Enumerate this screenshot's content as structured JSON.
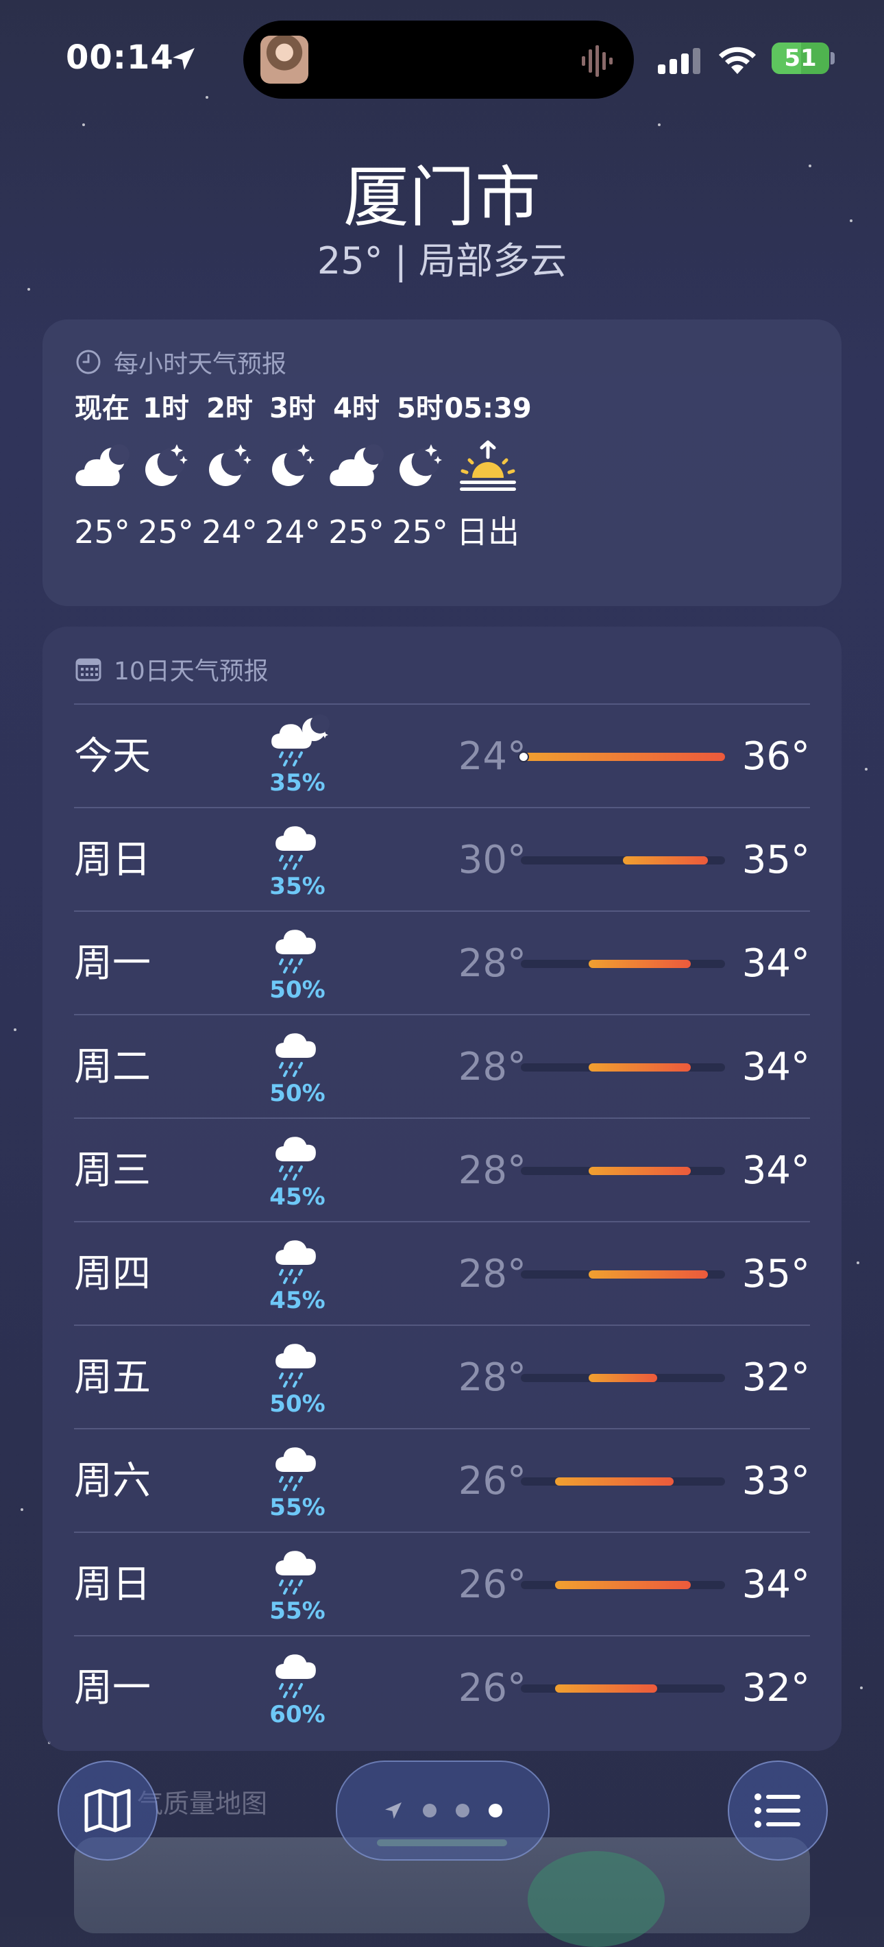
{
  "status_bar": {
    "time": "00:14",
    "battery": "51",
    "battery_level": 0.51,
    "icons": [
      "location-arrow-icon",
      "audio-wave-icon",
      "cellular-signal-icon",
      "wifi-icon",
      "battery-charging-icon"
    ]
  },
  "header": {
    "city": "厦门市",
    "summary": "25° | 局部多云"
  },
  "hourly": {
    "title": "每小时天气预报",
    "title_icon": "clock-icon",
    "items": [
      {
        "time": "现在",
        "icon": "partly-cloudy-night-icon",
        "temp": "25°"
      },
      {
        "time": "1时",
        "icon": "clear-night-icon",
        "temp": "25°"
      },
      {
        "time": "2时",
        "icon": "clear-night-icon",
        "temp": "24°"
      },
      {
        "time": "3时",
        "icon": "clear-night-icon",
        "temp": "24°"
      },
      {
        "time": "4时",
        "icon": "partly-cloudy-night-icon",
        "temp": "25°"
      },
      {
        "time": "5时",
        "icon": "clear-night-icon",
        "temp": "25°"
      },
      {
        "time": "05:39",
        "icon": "sunrise-icon",
        "temp": "日出"
      }
    ]
  },
  "daily": {
    "title": "10日天气预报",
    "title_icon": "calendar-icon",
    "scale_min": 24,
    "scale_max": 36,
    "days": [
      {
        "day": "今天",
        "icon": "rain-night-icon",
        "pop": "35%",
        "low": "24°",
        "high": "36°",
        "low_val": 24,
        "high_val": 36,
        "current_val": 24
      },
      {
        "day": "周日",
        "icon": "rain-icon",
        "pop": "35%",
        "low": "30°",
        "high": "35°",
        "low_val": 30,
        "high_val": 35
      },
      {
        "day": "周一",
        "icon": "rain-icon",
        "pop": "50%",
        "low": "28°",
        "high": "34°",
        "low_val": 28,
        "high_val": 34
      },
      {
        "day": "周二",
        "icon": "rain-icon",
        "pop": "50%",
        "low": "28°",
        "high": "34°",
        "low_val": 28,
        "high_val": 34
      },
      {
        "day": "周三",
        "icon": "rain-icon",
        "pop": "45%",
        "low": "28°",
        "high": "34°",
        "low_val": 28,
        "high_val": 34
      },
      {
        "day": "周四",
        "icon": "rain-icon",
        "pop": "45%",
        "low": "28°",
        "high": "35°",
        "low_val": 28,
        "high_val": 35
      },
      {
        "day": "周五",
        "icon": "rain-icon",
        "pop": "50%",
        "low": "28°",
        "high": "32°",
        "low_val": 28,
        "high_val": 32
      },
      {
        "day": "周六",
        "icon": "rain-icon",
        "pop": "55%",
        "low": "26°",
        "high": "33°",
        "low_val": 26,
        "high_val": 33
      },
      {
        "day": "周日",
        "icon": "rain-icon",
        "pop": "55%",
        "low": "26°",
        "high": "34°",
        "low_val": 26,
        "high_val": 34
      },
      {
        "day": "周一",
        "icon": "rain-icon",
        "pop": "60%",
        "low": "26°",
        "high": "32°",
        "low_val": 26,
        "high_val": 32
      }
    ]
  },
  "bottom": {
    "peek_label": "气质量地图",
    "map_icon": "map-icon",
    "list_icon": "list-icon",
    "pager_icons": [
      "location-arrow-icon",
      "page-dot-icon",
      "page-dot-icon",
      "page-dot-icon"
    ],
    "active_page": 3
  },
  "colors": {
    "background": "#2e3254",
    "card": "#3e4268",
    "precip": "#6ec8f7",
    "low_temp": "#8c90ad",
    "range_warm": "#f0a030",
    "range_hot": "#ec5a3c",
    "battery": "#4fb34f",
    "sun": "#f5c542"
  }
}
